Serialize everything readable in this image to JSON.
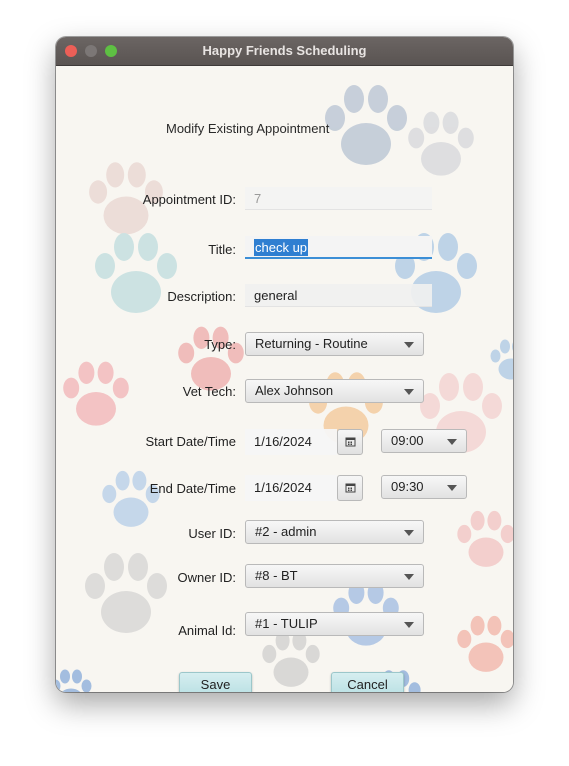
{
  "window": {
    "title": "Happy Friends Scheduling"
  },
  "form": {
    "heading": "Modify Existing Appointment",
    "appointment_id": {
      "label": "Appointment ID:",
      "value": "7"
    },
    "title": {
      "label": "Title:",
      "value": "check up"
    },
    "description": {
      "label": "Description:",
      "value": "general"
    },
    "type": {
      "label": "Type:",
      "value": "Returning - Routine"
    },
    "vet_tech": {
      "label": "Vet Tech:",
      "value": "Alex Johnson"
    },
    "start": {
      "label": "Start Date/Time",
      "date": "1/16/2024",
      "time": "09:00"
    },
    "end": {
      "label": "End Date/Time",
      "date": "1/16/2024",
      "time": "09:30"
    },
    "user_id": {
      "label": "User ID:",
      "value": "#2 - admin"
    },
    "owner_id": {
      "label": "Owner ID:",
      "value": "#8 - BT"
    },
    "animal_id": {
      "label": "Animal Id:",
      "value": "#1 - TULIP"
    }
  },
  "buttons": {
    "save": "Save",
    "cancel": "Cancel"
  },
  "icons": {
    "calendar": "calendar-icon",
    "dropdown": "chevron-down-icon"
  },
  "colors": {
    "button_bg": "#b9e0e3",
    "focus": "#3b8ed6",
    "selection": "#2f7fd1"
  }
}
